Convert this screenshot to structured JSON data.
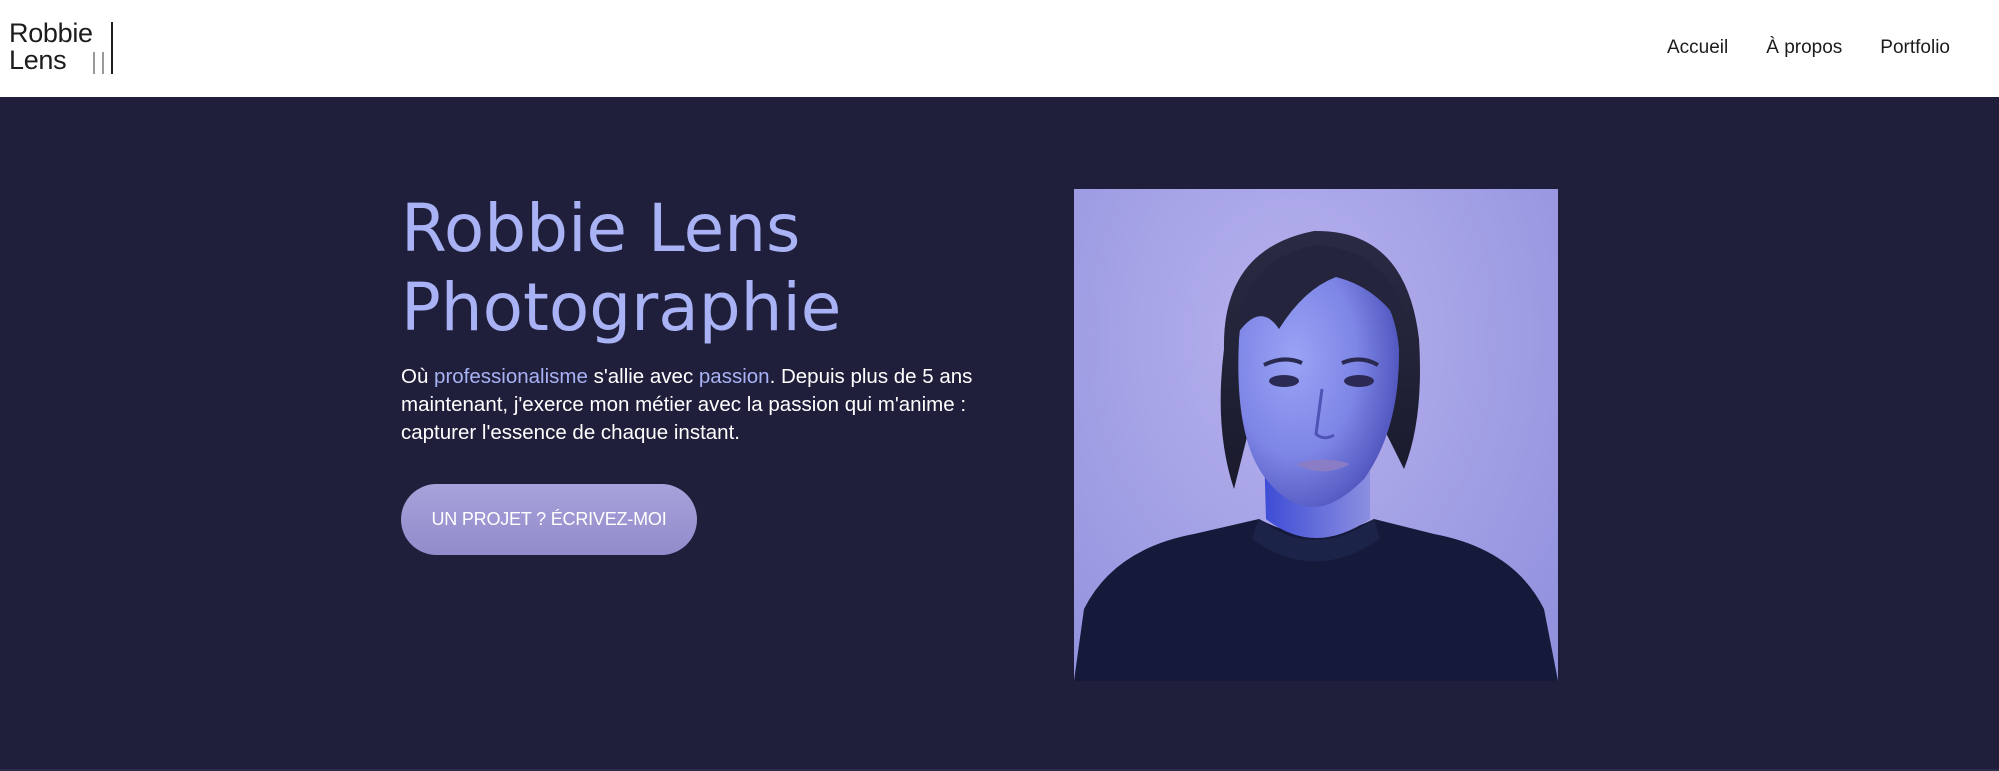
{
  "header": {
    "logo": {
      "line1": "Robbie",
      "line2": "Lens"
    },
    "nav": [
      {
        "label": "Accueil"
      },
      {
        "label": "À propos"
      },
      {
        "label": "Portfolio"
      }
    ]
  },
  "hero": {
    "title_line1": "Robbie Lens",
    "title_line2": "Photographie",
    "text": {
      "part1": "Où ",
      "highlight1": "professionalisme",
      "part2": " s'allie avec ",
      "highlight2": "passion",
      "part3": ". Depuis plus de 5 ans maintenant, j'exerce mon métier avec la passion qui m'anime : capturer l'essence de chaque instant."
    },
    "cta_label": "UN PROJET ? ÉCRIVEZ-MOI"
  },
  "colors": {
    "header_bg": "#ffffff",
    "hero_bg": "#1f1f3b",
    "accent": "#a8b2f4",
    "button": "#9d98d3",
    "text_light": "#ffffff",
    "text_dark": "#1c1c1c"
  }
}
